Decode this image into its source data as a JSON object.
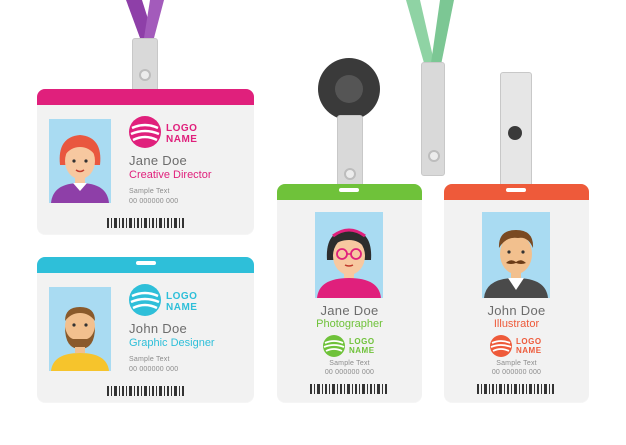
{
  "cards": [
    {
      "id": "jane-creative",
      "name": "Jane Doe",
      "role": "Creative Director",
      "sample": "Sample Text",
      "number": "00 000000 000",
      "accent": "#e0207c",
      "logo_line1": "LOGO",
      "logo_line2": "NAME",
      "logo_color": "#e0207c"
    },
    {
      "id": "john-graphic",
      "name": "John Doe",
      "role": "Graphic Designer",
      "sample": "Sample Text",
      "number": "00 000000 000",
      "accent": "#2ebfd9",
      "logo_line1": "LOGO",
      "logo_line2": "NAME",
      "logo_color": "#2ebfd9"
    },
    {
      "id": "jane-photo",
      "name": "Jane Doe",
      "role": "Photographer",
      "sample": "Sample Text",
      "number": "00 000000 000",
      "accent": "#6fc23a",
      "logo_line1": "LOGO",
      "logo_line2": "NAME",
      "logo_color": "#6fc23a"
    },
    {
      "id": "john-illus",
      "name": "John Doe",
      "role": "Illustrator",
      "sample": "Sample Text",
      "number": "00 000000 000",
      "accent": "#ee5a3a",
      "logo_line1": "LOGO",
      "logo_line2": "NAME",
      "logo_color": "#ee5a3a"
    }
  ],
  "colors": {
    "purple_lanyard": "#8e3fa8",
    "green_lanyard": "#8fd3a4",
    "reel": "#3a3a3a",
    "photo_bg": "#a9dbf2"
  }
}
